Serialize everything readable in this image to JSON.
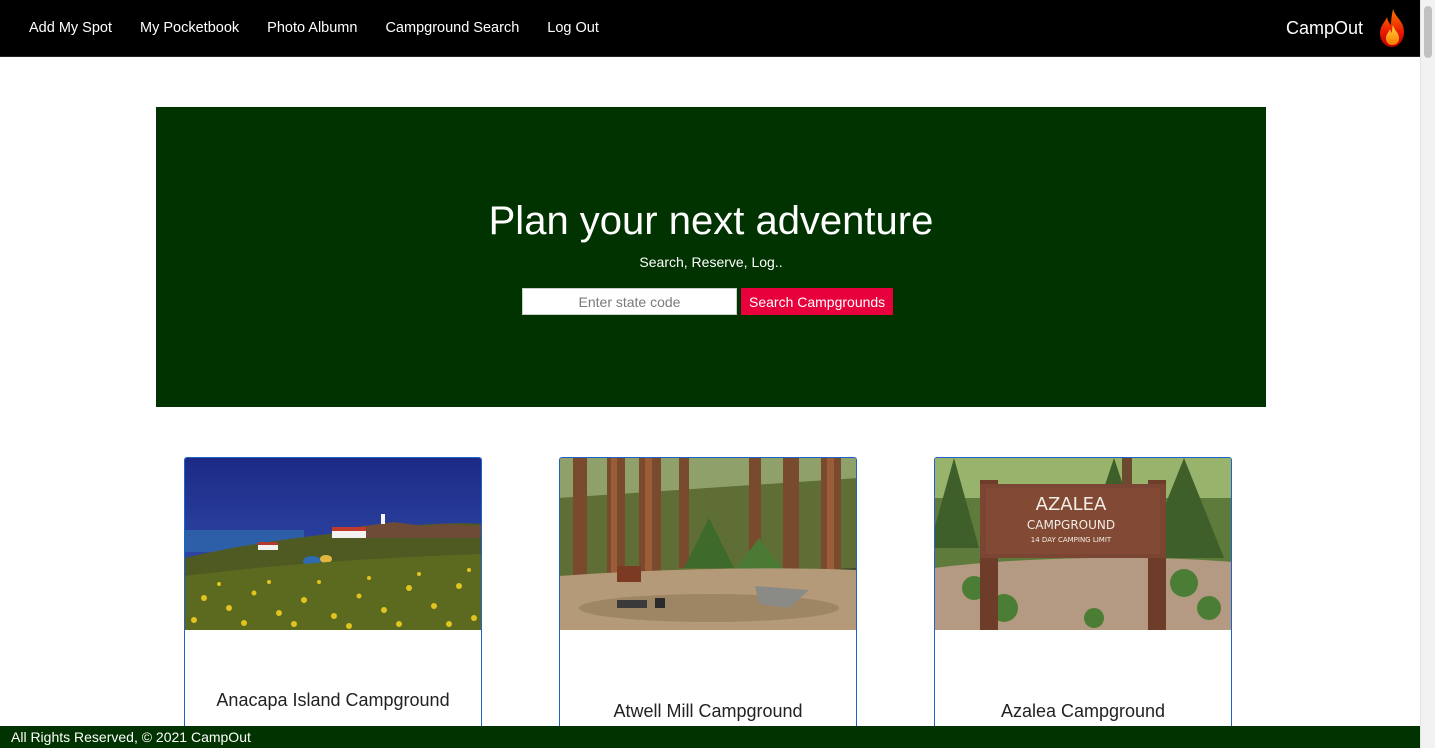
{
  "navbar": {
    "links": [
      "Add My Spot",
      "My Pocketbook",
      "Photo Albumn",
      "Campground Search",
      "Log Out"
    ],
    "brand": "CampOut",
    "brand_icon": "flame-icon"
  },
  "hero": {
    "title": "Plan your next adventure",
    "subtitle": "Search, Reserve, Log..",
    "search_placeholder": "Enter state code",
    "search_value": "",
    "search_button": "Search Campgrounds",
    "background": "#003300",
    "button_color": "#e8003d"
  },
  "campgrounds": [
    {
      "name": "Anacapa Island Campground",
      "image": "coastal-island-photo"
    },
    {
      "name": "Atwell Mill Campground",
      "image": "sequoia-forest-photo"
    },
    {
      "name": "Azalea Campground",
      "image": "azalea-sign-photo"
    }
  ],
  "footer": {
    "text": "All Rights Reserved, © 2021 CampOut"
  },
  "colors": {
    "nav_bg": "#000000",
    "hero_bg": "#003300",
    "footer_bg": "#003300",
    "card_border": "#1e63c7",
    "accent": "#e8003d"
  }
}
